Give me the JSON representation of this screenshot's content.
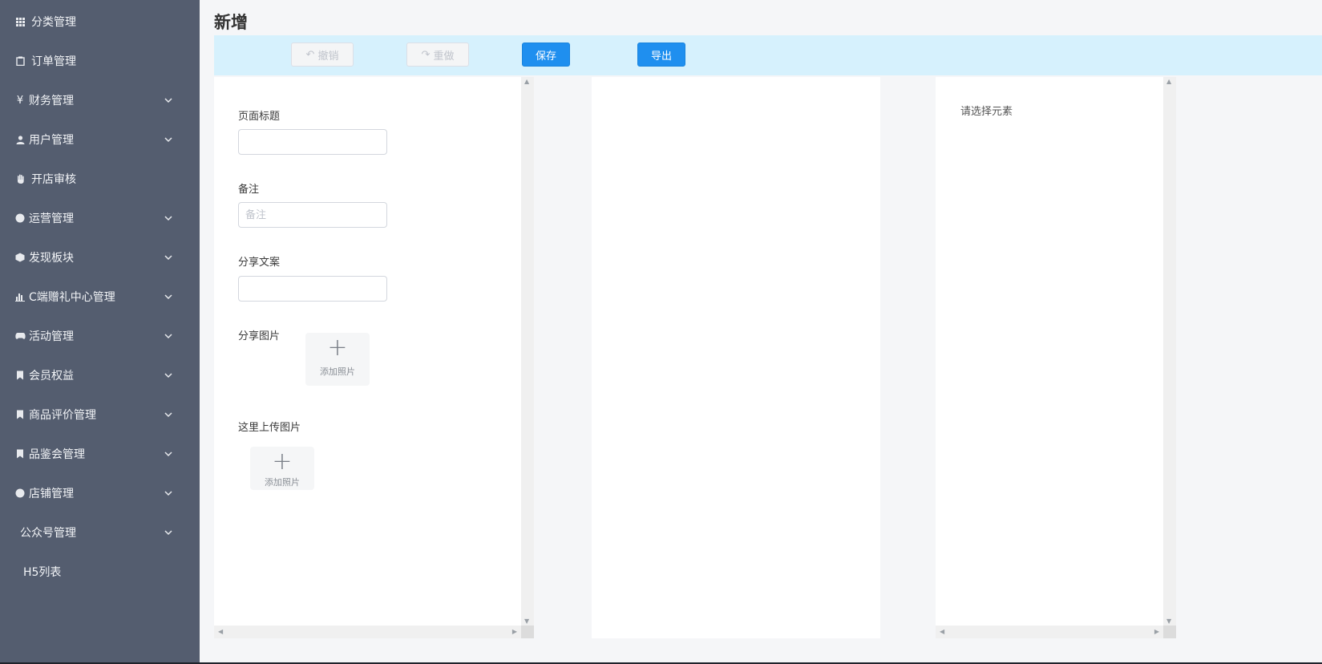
{
  "sidebar": {
    "items": [
      {
        "label": "分类管理",
        "icon": "grid-icon",
        "has_chevron": false
      },
      {
        "label": "订单管理",
        "icon": "clipboard-icon",
        "has_chevron": false
      },
      {
        "label": "财务管理",
        "icon": "yen-icon",
        "has_chevron": true
      },
      {
        "label": "用户管理",
        "icon": "user-icon",
        "has_chevron": true
      },
      {
        "label": "开店审核",
        "icon": "hand-icon",
        "has_chevron": false
      },
      {
        "label": "运营管理",
        "icon": "pie-icon",
        "has_chevron": true
      },
      {
        "label": "发现板块",
        "icon": "cube-icon",
        "has_chevron": true
      },
      {
        "label": "C端赠礼中心管理",
        "icon": "bar-chart-icon",
        "has_chevron": true
      },
      {
        "label": "活动管理",
        "icon": "gamepad-icon",
        "has_chevron": true
      },
      {
        "label": "会员权益",
        "icon": "bookmark-icon",
        "has_chevron": true
      },
      {
        "label": "商品评价管理",
        "icon": "bookmark-icon",
        "has_chevron": true
      },
      {
        "label": "品鉴会管理",
        "icon": "bookmark-icon",
        "has_chevron": true
      },
      {
        "label": "店铺管理",
        "icon": "pie-icon",
        "has_chevron": true
      },
      {
        "label": "公众号管理",
        "icon": "",
        "has_chevron": true
      },
      {
        "label": "H5列表",
        "icon": "",
        "has_chevron": false
      }
    ]
  },
  "page": {
    "title": "新增"
  },
  "toolbar": {
    "undo_label": "撤销",
    "redo_label": "重做",
    "save_label": "保存",
    "export_label": "导出"
  },
  "form": {
    "page_title_label": "页面标题",
    "page_title_value": "",
    "remark_label": "备注",
    "remark_placeholder": "备注",
    "share_text_label": "分享文案",
    "share_text_value": "",
    "share_image_label": "分享图片",
    "share_image_upload_label": "添加照片",
    "upload_image_label": "这里上传图片",
    "upload_image_upload_label": "添加照片"
  },
  "right_panel": {
    "hint": "请选择元素"
  }
}
